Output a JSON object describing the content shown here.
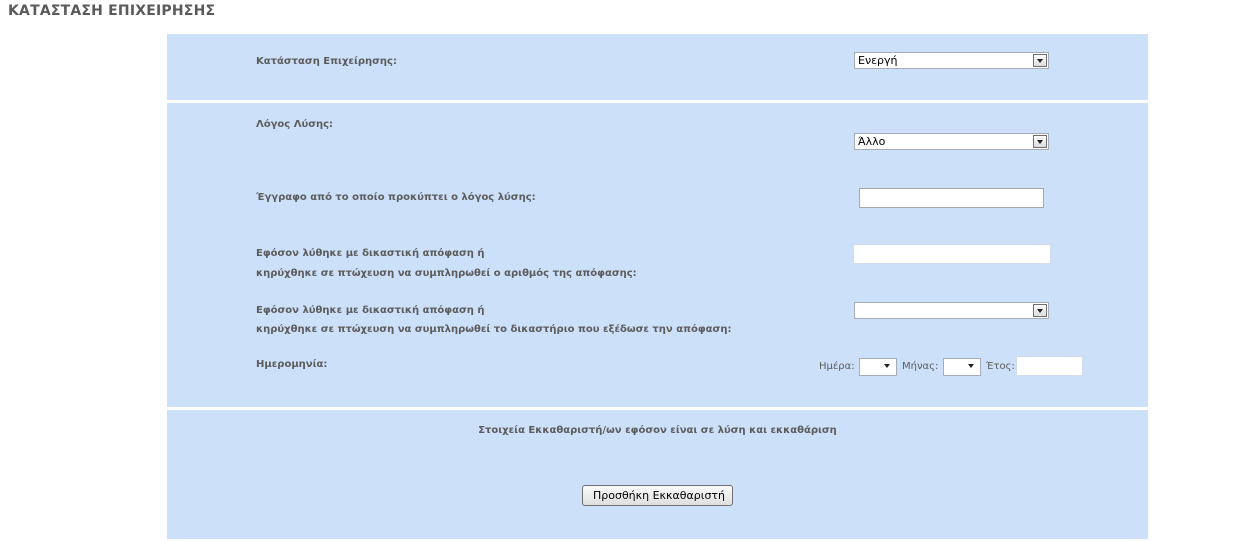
{
  "page": {
    "title": "ΚΑΤΑΣΤΑΣΗ ΕΠΙΧΕΙΡΗΣΗΣ"
  },
  "status_section": {
    "label": "Κατάσταση Επιχείρησης:",
    "selected": "Ενεργή"
  },
  "dissolution_section": {
    "reason": {
      "label": "Λόγος Λύσης:",
      "selected": "Άλλο"
    },
    "document": {
      "label": "Έγγραφο από το οποίο προκύπτει ο λόγος λύσης:",
      "value": ""
    },
    "decision_number": {
      "label_line1": "Εφόσον λύθηκε με δικαστική απόφαση ή",
      "label_line2": "κηρύχθηκε σε πτώχευση να συμπληρωθεί ο αριθμός της απόφασης:",
      "value": ""
    },
    "court": {
      "label_line1": "Εφόσον λύθηκε με δικαστική απόφαση ή",
      "label_line2": "κηρύχθηκε σε πτώχευση να συμπληρωθεί το δικαστήριο που εξέδωσε την απόφαση:",
      "selected": ""
    },
    "date": {
      "label": "Ημερομηνία:",
      "day_label": "Ημέρα:",
      "month_label": "Μήνας:",
      "year_label": "Έτος:",
      "day": "",
      "month": "",
      "year": ""
    }
  },
  "liquidators_section": {
    "heading": "Στοιχεία Εκκαθαριστή/ων εφόσον είναι σε λύση και εκκαθάριση",
    "add_button": "Προσθήκη Εκκαθαριστή"
  }
}
